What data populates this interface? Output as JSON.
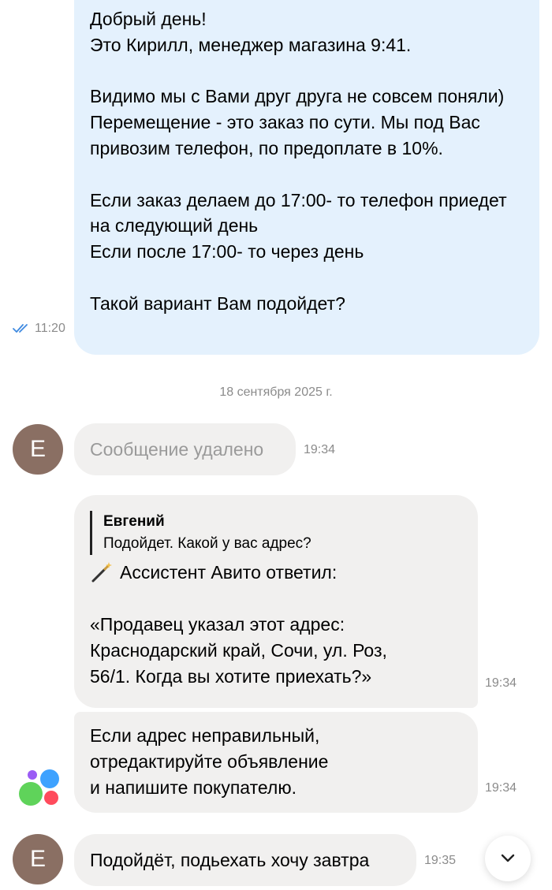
{
  "messages": {
    "m1": {
      "text": "Добрый день!\nЭто Кирилл, менеджер магазина 9:41.\n\nВидимо мы с Вами друг друга не совсем поняли) Перемещение - это заказ по сути. Мы под Вас привозим телефон, по предоплате в 10%.\n\nЕсли заказ делаем до 17:00- то телефон приедет на следующий день\nЕсли после 17:00- то через день\n\nТакой вариант Вам подойдет?",
      "time": "11:20"
    },
    "date_separator": "18 сентября 2025 г.",
    "m2": {
      "avatar_letter": "Е",
      "text": "Сообщение удалено",
      "time": "19:34"
    },
    "m3": {
      "quote_author": "Евгений",
      "quote_text": "Подойдет. Какой у вас адрес?",
      "assistant_label": "Ассистент Авито ответил:",
      "text": "«Продавец указал этот адрес: Краснодарский край, Сочи, ул. Роз, 56/1. Когда вы хотите приехать?»",
      "time": "19:34"
    },
    "m4": {
      "text": "Если адрес неправильный,\nотредактируйте объявление\nи напишите покупателю.",
      "time": "19:34"
    },
    "m5": {
      "avatar_letter": "Е",
      "text": "Подойдёт, подьехать хочу завтра",
      "time": "19:35"
    }
  },
  "colors": {
    "outgoing_bubble": "#e4f1fd",
    "incoming_bubble": "#f1f0ef",
    "avatar": "#8a6f63",
    "read_check": "#3f8ae0"
  },
  "icons": {
    "read": "double-check-icon",
    "assistant": "magic-wand-icon",
    "avito_logo": "avito-logo-icon",
    "scroll": "chevron-down-icon"
  }
}
